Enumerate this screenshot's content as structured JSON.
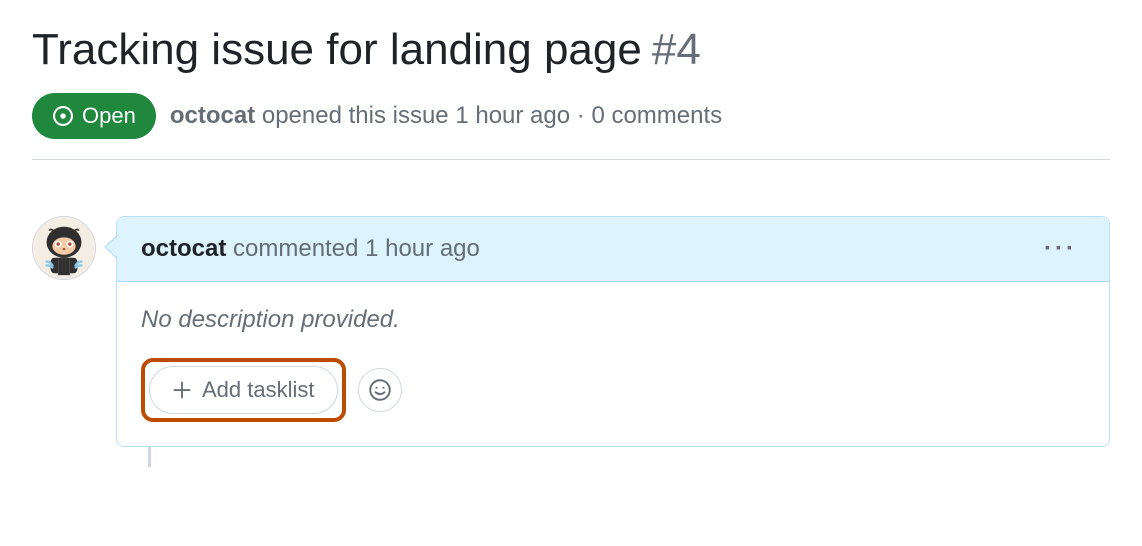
{
  "issue": {
    "title": "Tracking issue for landing page",
    "number": "#4",
    "state": "Open",
    "author": "octocat",
    "opened_text": "opened this issue",
    "time_ago": "1 hour ago",
    "separator": "·",
    "comments_count": "0 comments"
  },
  "comment": {
    "author": "octocat",
    "action": "commented",
    "time_ago": "1 hour ago",
    "body_placeholder": "No description provided.",
    "add_tasklist_label": "Add tasklist"
  }
}
